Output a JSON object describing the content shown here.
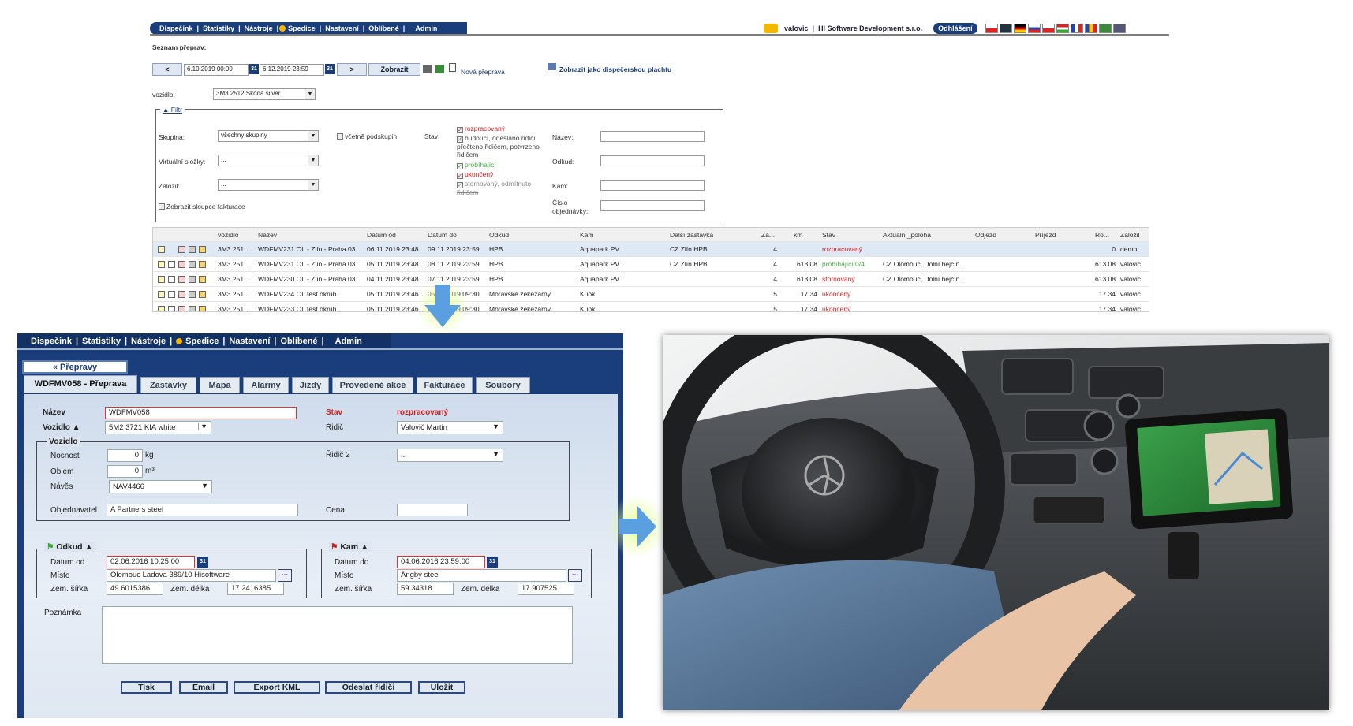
{
  "top": {
    "nav": [
      "Dispečink",
      "Statistiky",
      "Nástroje",
      "Spedice",
      "Nastavení",
      "Oblíbené",
      "Admin"
    ],
    "user": "valovic",
    "company": "HI Software Development s.r.o.",
    "logout": "Odhlášení",
    "list_title": "Seznam přeprav:",
    "date_from": "6.10.2019 00:00",
    "date_to": "6.12.2019 23:59",
    "prev": "<",
    "next": ">",
    "show": "Zobrazit",
    "new_transport": "Nová přeprava",
    "dispatch_board": "Zobrazit jako dispečerskou plachtu",
    "vehicle_label": "vozidlo:",
    "vehicle_value": "3M3 2512 Skoda silver",
    "filter_label": "Filtr",
    "filter": {
      "group_label": "Skupina:",
      "group_value": "všechny skupiny",
      "subgroups": "včetně podskupin",
      "virtual_label": "Virtuální složky:",
      "virtual_value": "...",
      "founder_label": "Založil:",
      "founder_value": "...",
      "invoice_cols": "Zobrazit sloupce fakturace",
      "state_label": "Stav:",
      "states": [
        "rozpracovaný",
        "budoucí, odesláno řidiči, přečteno řidičem, potvrzeno řidičem",
        "probíhající",
        "ukončený",
        "stornovaný, odmítnuto řidičem"
      ],
      "name_label": "Název:",
      "from_label": "Odkud:",
      "to_label": "Kam:",
      "order_label": "Číslo objednávky:"
    },
    "columns": [
      "vozidlo",
      "Název",
      "Datum od",
      "Datum do",
      "Odkud",
      "Kam",
      "Další zastávka",
      "Za...",
      "km",
      "Stav",
      "Aktuální_poloha",
      "Odjezd",
      "Příjezd",
      "Ro...",
      "Založil"
    ],
    "rows": [
      [
        "3M3 251...",
        "WDFMV231 OL - Zlín - Praha 03",
        "06.11.2019 23:48",
        "09.11.2019 23:59",
        "HPB",
        "Aquapark PV",
        "CZ Zlín HPB",
        "4",
        "",
        "rozpracovaný",
        "",
        "",
        "",
        "0",
        "demo"
      ],
      [
        "3M3 251...",
        "WDFMV231 OL - Zlín - Praha 03",
        "05.11.2019 23:48",
        "08.11.2019 23:59",
        "HPB",
        "Aquapark PV",
        "CZ Zlín HPB",
        "4",
        "613.08",
        "probíhající 0/4",
        "CZ Olomouc, Dolní hejčín...",
        "",
        "",
        "613.08",
        "valovic"
      ],
      [
        "3M3 251...",
        "WDFMV230 OL - Zlín - Praha 03",
        "04.11.2019 23:48",
        "07.11.2019 23:59",
        "HPB",
        "Aquapark PV",
        "",
        "4",
        "613.08",
        "stornovaný",
        "CZ Olomouc, Dolní hejčín...",
        "",
        "",
        "613.08",
        "valovic"
      ],
      [
        "3M3 251...",
        "WDFMV234 OL test okruh",
        "05.11.2019 23:46",
        "05.11.2019 09:30",
        "Moravské žekezárny",
        "Kúok",
        "",
        "5",
        "17.34",
        "ukončený",
        "",
        "",
        "",
        "17.34",
        "valovic"
      ],
      [
        "3M3 251...",
        "WDFMV233 OL test okruh",
        "05.11.2019 23:46",
        "05.11.2019 09:30",
        "Moravské žekezárny",
        "Kúok",
        "",
        "5",
        "17.34",
        "ukončený",
        "",
        "",
        "",
        "17.34",
        "valovic"
      ]
    ]
  },
  "detail": {
    "nav": [
      "Dispečink",
      "Statistiky",
      "Nástroje",
      "Spedice",
      "Nastavení",
      "Oblíbené",
      "Admin"
    ],
    "back": "« Přepravy",
    "tabs": [
      "WDFMV058 - Přeprava",
      "Zastávky",
      "Mapa",
      "Alarmy",
      "Jízdy",
      "Provedené akce",
      "Fakturace",
      "Soubory"
    ],
    "name_label": "Název",
    "name_value": "WDFMV058",
    "state_label": "Stav",
    "state_value": "rozpracovaný",
    "vehicle_label": "Vozidlo",
    "vehicle_value": "5M2 3721 KIA white",
    "driver_label": "Řidič",
    "driver_value": "Valovič Martin",
    "driver2_label": "Řidič 2",
    "driver2_value": "...",
    "vehicle_section": "Vozidlo",
    "load_label": "Nosnost",
    "load_value": "0",
    "load_unit": "kg",
    "volume_label": "Objem",
    "volume_value": "0",
    "volume_unit": "m³",
    "trailer_label": "Návěs",
    "trailer_value": "NAV4466",
    "customer_label": "Objednavatel",
    "customer_value": "A Partners steel",
    "price_label": "Cena",
    "from_section": "Odkud",
    "from_date_label": "Datum od",
    "from_date": "02.06.2016 10:25:00",
    "from_place_label": "Místo",
    "from_place": "Olomouc Ladova 389/10 Hisoftware",
    "lat_label": "Zem. šířka",
    "from_lat": "49.6015386",
    "lon_label": "Zem. délka",
    "from_lon": "17.2416385",
    "to_section": "Kam",
    "to_date_label": "Datum do",
    "to_date": "04.06.2016 23:59:00",
    "to_place_label": "Místo",
    "to_place": "Angby steel",
    "to_lat": "59.34318",
    "to_lon": "17.907525",
    "note_label": "Poznámka",
    "buttons": [
      "Tisk",
      "Email",
      "Export KML",
      "Odeslat řidiči",
      "Uložit"
    ]
  },
  "colors": {
    "navy": "#1a3d7c",
    "red": "#cc2222",
    "green": "#4caf50",
    "gray_arrow": "#5aa0e0"
  }
}
